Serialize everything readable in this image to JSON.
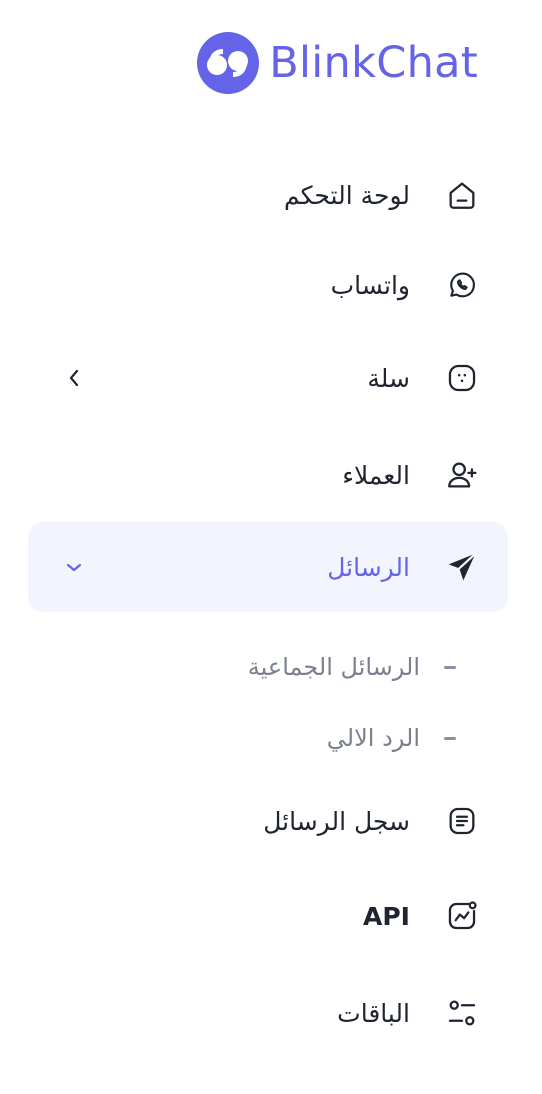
{
  "brand": {
    "name": "BlinkChat",
    "color": "#6563e8"
  },
  "menu": [
    {
      "label": "لوحة التحكم",
      "icon": "home-icon"
    },
    {
      "label": "واتساب",
      "icon": "whatsapp-icon"
    },
    {
      "label": "سلة",
      "icon": "salla-icon"
    },
    {
      "label": "العملاء",
      "icon": "user-plus-icon"
    },
    {
      "label": "الرسائل",
      "icon": "send-icon",
      "active": true
    },
    {
      "label": "سجل الرسائل",
      "icon": "message-log-icon"
    },
    {
      "label": "API",
      "icon": "api-chart-icon"
    },
    {
      "label": "الباقات",
      "icon": "packages-icon"
    }
  ],
  "submenu": [
    {
      "label": "الرسائل الجماعية"
    },
    {
      "label": "الرد الالي"
    }
  ],
  "colors": {
    "accent": "#6563e8",
    "active_bg": "#f2f5fd",
    "text": "#1f2430",
    "muted": "#7b8090"
  }
}
